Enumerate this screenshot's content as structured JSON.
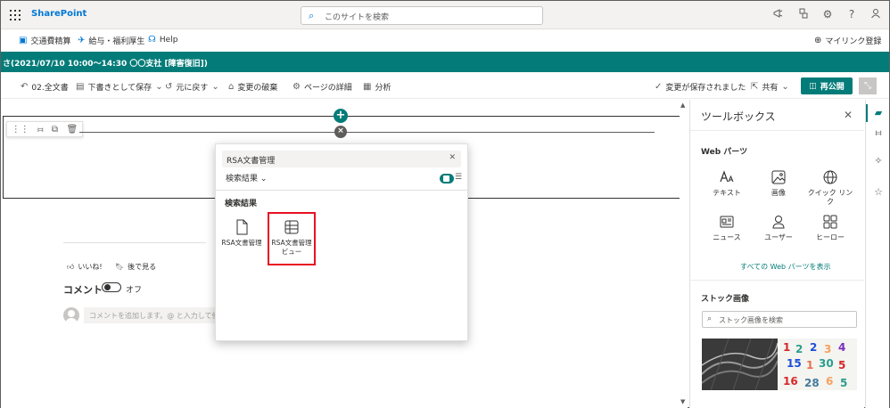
{
  "suite": {
    "brand": "SharePoint",
    "search_placeholder": "このサイトを検索",
    "icons": [
      "megaphone-icon",
      "share-icon",
      "gear-icon",
      "help-icon",
      "person-icon"
    ]
  },
  "quick_links": [
    {
      "label": "交通費精算",
      "icon": "bus-icon"
    },
    {
      "label": "給与・福利厚生",
      "icon": "airplane-icon"
    },
    {
      "label": "Help",
      "icon": "headset-icon"
    }
  ],
  "my_links": "マイリンク登録",
  "title_bar": "さ(2021/07/10 10:00～14:30 〇〇支社 [障害復旧])",
  "command_bar": {
    "page": "02.全文書",
    "save_draft": "下書きとして保存",
    "undo": "元に戻す",
    "discard": "変更の破棄",
    "page_details": "ページの詳細",
    "analytics": "分析",
    "saved_status": "変更が保存されました",
    "share": "共有",
    "republish": "再公開"
  },
  "canvas": {
    "like": "いいね!",
    "save_later": "後で見る",
    "comments_title": "コメント",
    "comments_toggle": "オフ",
    "comment_placeholder": "コメントを追加します。@ と入力して他のユーザーに"
  },
  "picker": {
    "search_value": "RSA文書管理",
    "filter_label": "検索結果",
    "section_title": "検索結果",
    "results": [
      {
        "label": "RSA文書管理",
        "icon": "document-icon"
      },
      {
        "label": "RSA文書管理ビュー",
        "icon": "table-icon"
      }
    ]
  },
  "toolbox": {
    "title": "ツールボックス",
    "webparts_title": "Web パーツ",
    "webparts": [
      {
        "label": "テキスト",
        "icon": "text-icon"
      },
      {
        "label": "画像",
        "icon": "image-icon"
      },
      {
        "label": "クイック リンク",
        "icon": "globe-icon"
      },
      {
        "label": "ニュース",
        "icon": "news-icon"
      },
      {
        "label": "ユーザー",
        "icon": "user-icon"
      },
      {
        "label": "ヒーロー",
        "icon": "hero-icon"
      }
    ],
    "show_all": "すべての Web パーツを表示",
    "stock_title": "ストック画像",
    "stock_search_placeholder": "ストック画像を検索"
  },
  "colors": {
    "accent": "#037c79",
    "brand_blue": "#0078d4",
    "highlight": "#e81123"
  }
}
